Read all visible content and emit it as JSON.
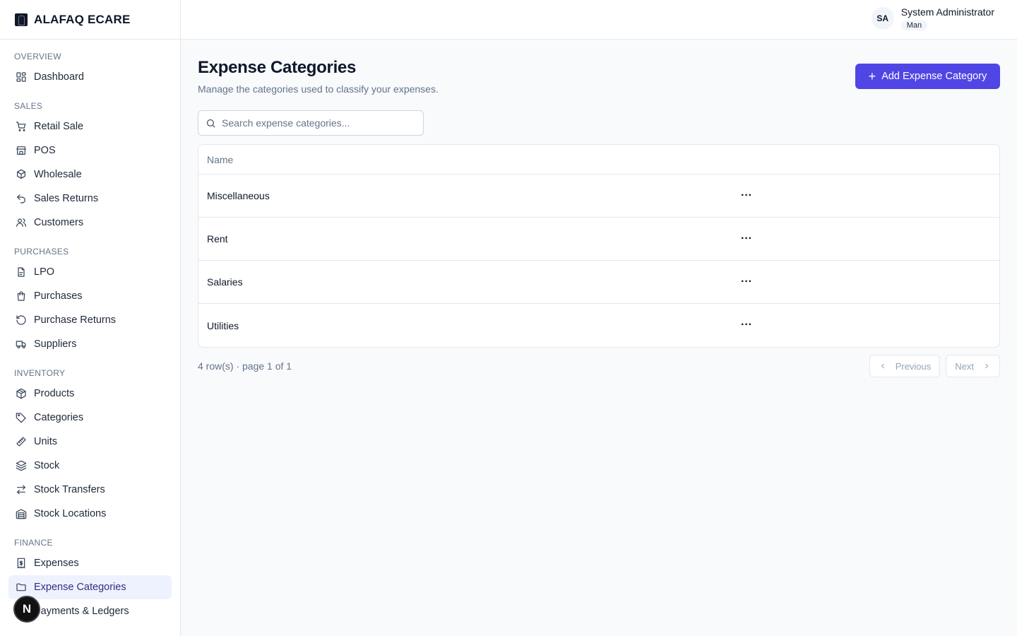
{
  "brand": {
    "name": "ALAFAQ ECARE"
  },
  "sidebar": {
    "sections": [
      {
        "title": "OVERVIEW",
        "items": [
          {
            "label": "Dashboard",
            "icon": "dashboard-icon"
          }
        ]
      },
      {
        "title": "SALES",
        "items": [
          {
            "label": "Retail Sale",
            "icon": "cart-icon"
          },
          {
            "label": "POS",
            "icon": "store-icon"
          },
          {
            "label": "Wholesale",
            "icon": "boxes-icon"
          },
          {
            "label": "Sales Returns",
            "icon": "undo-icon"
          },
          {
            "label": "Customers",
            "icon": "users-icon"
          }
        ]
      },
      {
        "title": "PURCHASES",
        "items": [
          {
            "label": "LPO",
            "icon": "document-icon"
          },
          {
            "label": "Purchases",
            "icon": "shopping-bag-icon"
          },
          {
            "label": "Purchase Returns",
            "icon": "rotate-ccw-icon"
          },
          {
            "label": "Suppliers",
            "icon": "truck-icon"
          }
        ]
      },
      {
        "title": "INVENTORY",
        "items": [
          {
            "label": "Products",
            "icon": "package-icon"
          },
          {
            "label": "Categories",
            "icon": "tag-icon"
          },
          {
            "label": "Units",
            "icon": "ruler-icon"
          },
          {
            "label": "Stock",
            "icon": "layers-icon"
          },
          {
            "label": "Stock Transfers",
            "icon": "arrows-exchange-icon"
          },
          {
            "label": "Stock Locations",
            "icon": "warehouse-icon"
          }
        ]
      },
      {
        "title": "FINANCE",
        "items": [
          {
            "label": "Expenses",
            "icon": "receipt-icon"
          },
          {
            "label": "Expense Categories",
            "icon": "folder-icon",
            "active": true
          },
          {
            "label": "Payments & Ledgers",
            "icon": "wallet-icon"
          }
        ]
      }
    ]
  },
  "user": {
    "initials": "SA",
    "name": "System Administrator",
    "role": "Man"
  },
  "page": {
    "title": "Expense Categories",
    "subtitle": "Manage the categories used to classify your expenses.",
    "add_button": "Add Expense Category",
    "search_placeholder": "Search expense categories..."
  },
  "table": {
    "columns": [
      "Name"
    ],
    "rows": [
      "Miscellaneous",
      "Rent",
      "Salaries",
      "Utilities"
    ],
    "actions_glyph": "···"
  },
  "pagination": {
    "info": "4 row(s) · page 1 of 1",
    "previous": "Previous",
    "next": "Next"
  },
  "dev_badge": "N",
  "colors": {
    "accent": "#4f46e5",
    "active_bg": "#eef2ff",
    "border": "#e5e7eb"
  }
}
